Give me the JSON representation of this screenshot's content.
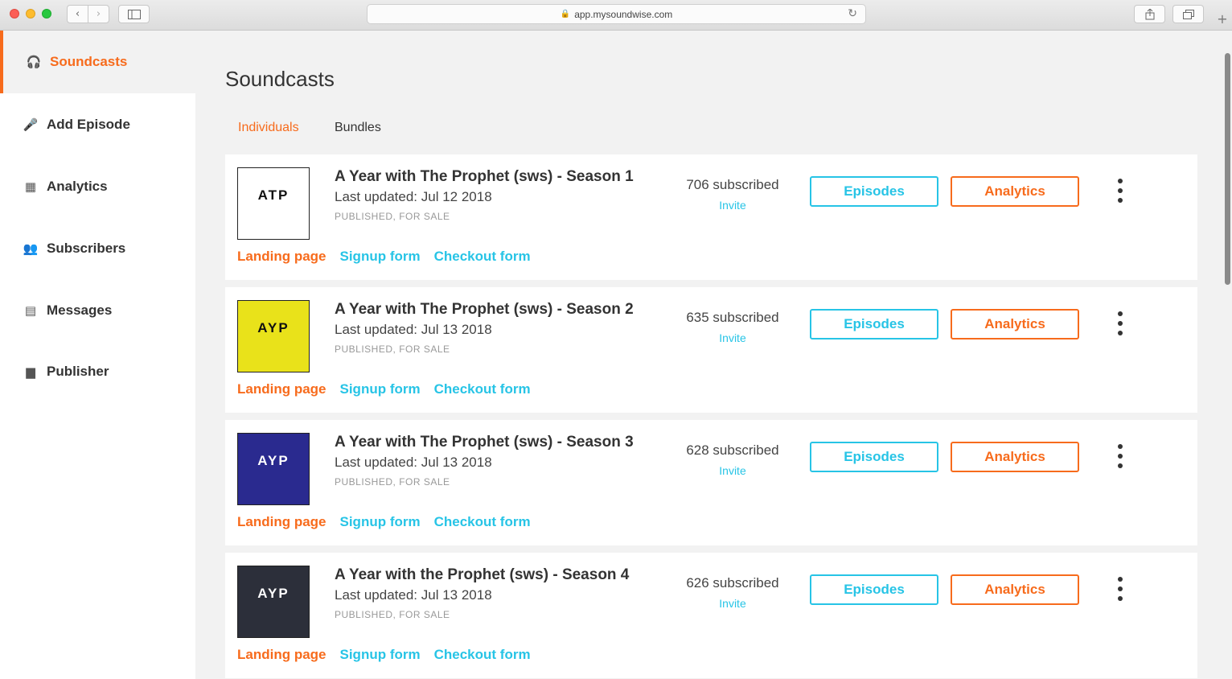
{
  "browser": {
    "url": "app.mysoundwise.com",
    "back_glyph": "‹",
    "forward_glyph": "›",
    "new_tab_glyph": "+",
    "reload_glyph": "↻",
    "lock_glyph": "🔒"
  },
  "sidebar": {
    "items": [
      {
        "label": "Soundcasts",
        "icon": "headphones-icon",
        "glyph": "🎧",
        "active": true
      },
      {
        "label": "Add Episode",
        "icon": "microphone-icon",
        "glyph": "🎤",
        "active": false
      },
      {
        "label": "Analytics",
        "icon": "bar-chart-icon",
        "glyph": "▦",
        "active": false
      },
      {
        "label": "Subscribers",
        "icon": "people-icon",
        "glyph": "👥",
        "active": false
      },
      {
        "label": "Messages",
        "icon": "message-icon",
        "glyph": "▤",
        "active": false
      },
      {
        "label": "Publisher",
        "icon": "briefcase-icon",
        "glyph": "▆",
        "active": false
      }
    ]
  },
  "main": {
    "title": "Soundcasts",
    "tabs": [
      {
        "label": "Individuals",
        "active": true
      },
      {
        "label": "Bundles",
        "active": false
      }
    ]
  },
  "soundcasts": [
    {
      "title": "A Year with The Prophet (sws) - Season 1",
      "updated": "Last updated: Jul 12 2018",
      "status": "PUBLISHED, FOR SALE",
      "subscribed": "706 subscribed",
      "invite": "Invite",
      "cover_text": "ATP",
      "cover_bg": "#ffffff",
      "cover_fg": "#111111"
    },
    {
      "title": "A Year with The Prophet (sws) - Season 2",
      "updated": "Last updated: Jul 13 2018",
      "status": "PUBLISHED, FOR SALE",
      "subscribed": "635 subscribed",
      "invite": "Invite",
      "cover_text": "AYP",
      "cover_bg": "#e9e21a",
      "cover_fg": "#111111"
    },
    {
      "title": "A Year with The Prophet (sws) - Season 3",
      "updated": "Last updated: Jul 13 2018",
      "status": "PUBLISHED, FOR SALE",
      "subscribed": "628 subscribed",
      "invite": "Invite",
      "cover_text": "AYP",
      "cover_bg": "#2a2a8f",
      "cover_fg": "#ffffff"
    },
    {
      "title": "A Year with the Prophet (sws) - Season 4",
      "updated": "Last updated: Jul 13 2018",
      "status": "PUBLISHED, FOR SALE",
      "subscribed": "626 subscribed",
      "invite": "Invite",
      "cover_text": "AYP",
      "cover_bg": "#2c2f3a",
      "cover_fg": "#ffffff"
    }
  ],
  "card_labels": {
    "landing": "Landing page",
    "signup": "Signup form",
    "checkout": "Checkout form",
    "episodes": "Episodes",
    "analytics": "Analytics"
  },
  "colors": {
    "accent_orange": "#f76b1c",
    "accent_blue": "#27c4e6"
  }
}
